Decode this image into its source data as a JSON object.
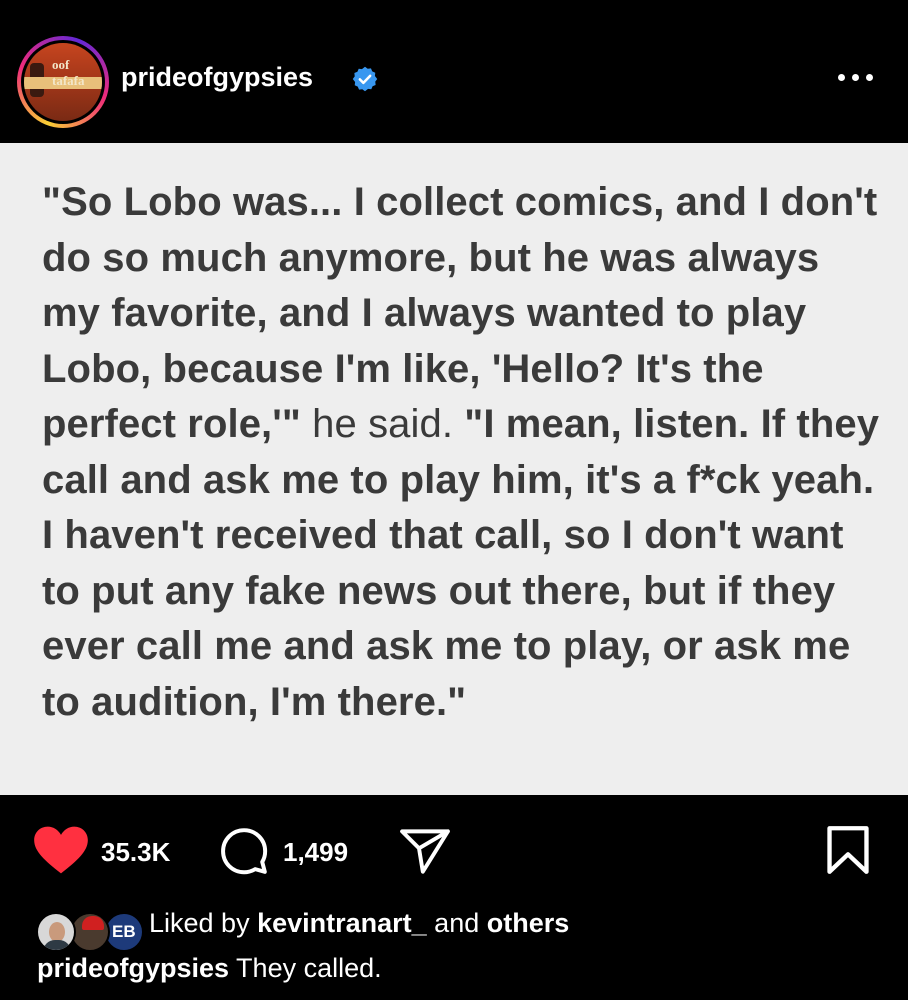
{
  "header": {
    "username": "prideofgypsies",
    "avatar_text": "oof tafafa",
    "more_icon": "more-horizontal-icon",
    "verified_icon": "verified-badge-icon"
  },
  "quote": {
    "bold_part_1": "\"So Lobo was... I collect comics, and I don't do so much anymore, but he was always my favorite, and I always wanted to play Lobo, because I'm like, 'Hello? It's the perfect role,'\"",
    "plain_part": " he said. ",
    "bold_part_2": "\"I mean, listen. If they call and ask me to play him, it's a f*ck yeah. I haven't received that call, so I don't want to put any fake news out there, but if they ever call me and ask me to play, or ask me to audition, I'm there.\""
  },
  "actions": {
    "like_count": "35.3K",
    "comment_count": "1,499",
    "like_icon": "heart-filled-icon",
    "comment_icon": "comment-icon",
    "share_icon": "share-icon",
    "save_icon": "bookmark-icon"
  },
  "likes": {
    "prefix": "Liked by ",
    "user": "kevintranart_",
    "middle": " and ",
    "suffix": "others",
    "liker3_badge": "EB"
  },
  "caption": {
    "username": "prideofgypsies",
    "text": " They called."
  },
  "colors": {
    "heart": "#ff3040",
    "verified": "#3897f0",
    "card_bg": "#eeeeee",
    "quote_text": "#3a3a3a"
  }
}
